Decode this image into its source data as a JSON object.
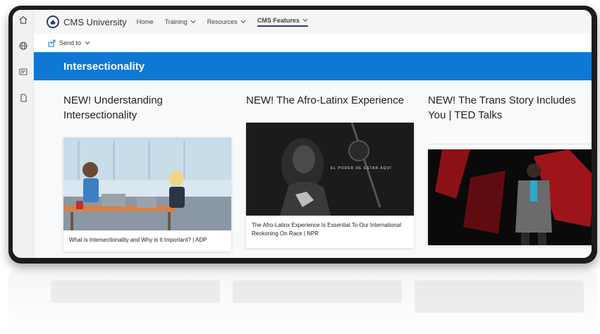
{
  "site": {
    "title": "CMS University",
    "nav": [
      {
        "label": "Home",
        "has_menu": false,
        "active": false
      },
      {
        "label": "Training",
        "has_menu": true,
        "active": false
      },
      {
        "label": "Resources",
        "has_menu": true,
        "active": false
      },
      {
        "label": "CMS Features",
        "has_menu": true,
        "active": true
      }
    ]
  },
  "appbar": {
    "icons": [
      "home-icon",
      "globe-icon",
      "news-icon",
      "document-icon"
    ]
  },
  "command_bar": {
    "send_to_label": "Send to",
    "send_to_icon": "share-icon"
  },
  "banner": {
    "title": "Intersectionality",
    "color": "#0f78d4"
  },
  "cards": [
    {
      "heading": "NEW! Understanding Intersectionality",
      "caption": "What is Intersectionality and Why is it Important? | ADP"
    },
    {
      "heading": "NEW! The Afro-Latinx Experience",
      "caption": "The Afro-Latinx Experience Is Essential To Our International Reckoning On Race | NPR",
      "image_overlay": "EL PODER DE ESTAR AQUÍ"
    },
    {
      "heading": "NEW! The Trans Story Includes You | TED Talks",
      "caption": ""
    }
  ]
}
